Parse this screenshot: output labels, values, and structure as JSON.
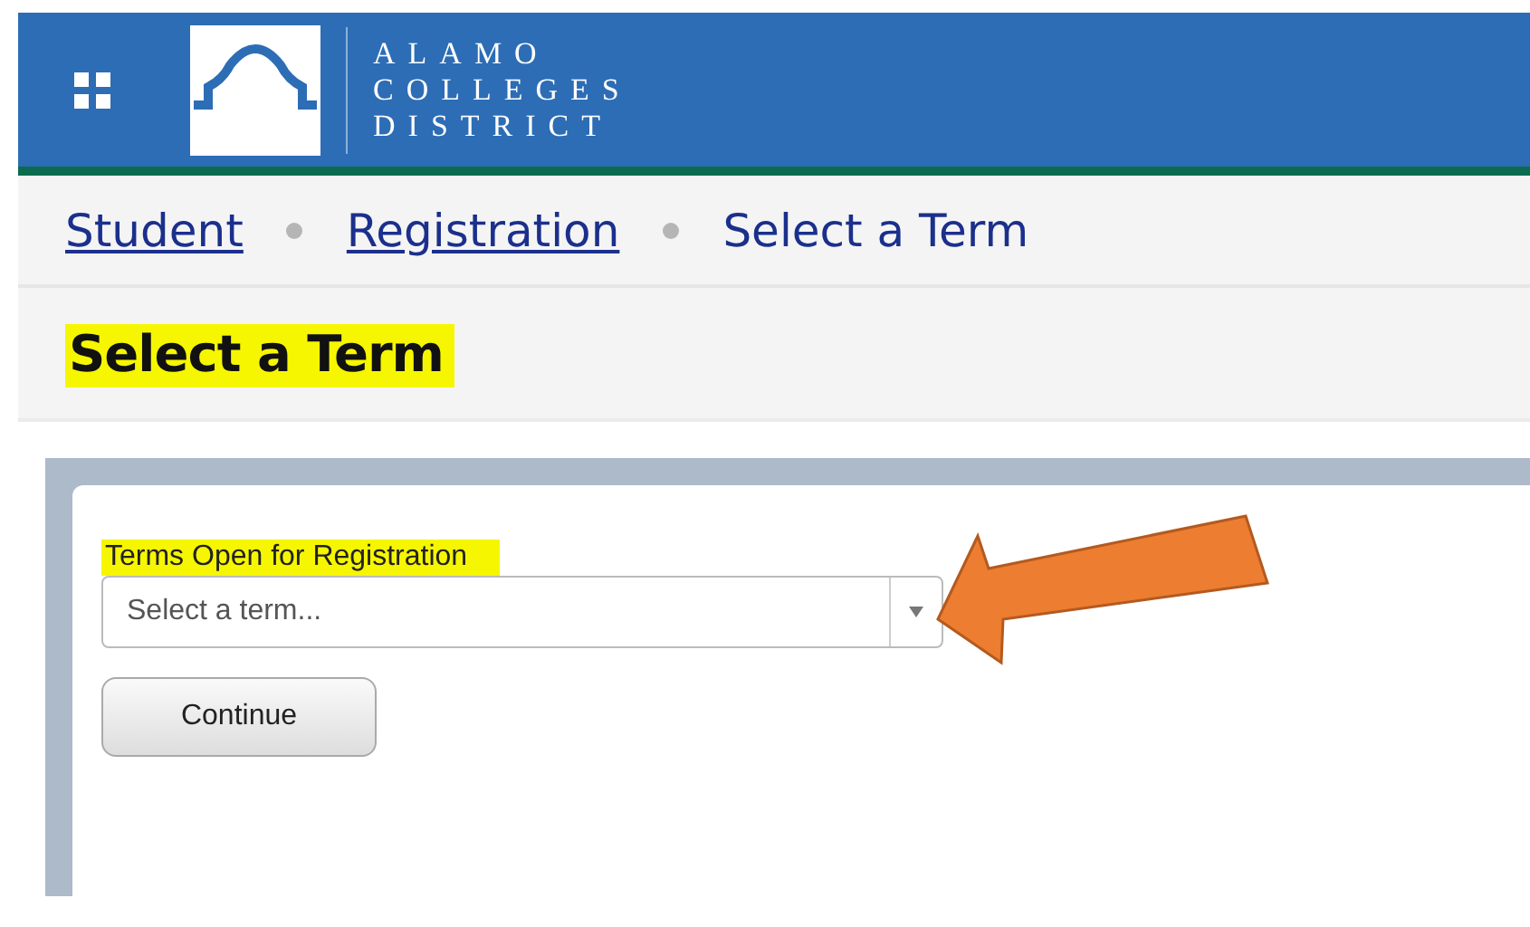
{
  "header": {
    "logo_lines": [
      "ALAMO",
      "COLLEGES",
      "DISTRICT"
    ]
  },
  "breadcrumb": [
    {
      "label": "Student",
      "kind": "link"
    },
    {
      "label": "Registration",
      "kind": "link"
    },
    {
      "label": "Select a Term",
      "kind": "current"
    }
  ],
  "heading": {
    "text": "Select a Term",
    "highlighted": true
  },
  "form": {
    "label": {
      "text": "Terms Open for Registration",
      "highlighted": true
    },
    "term_select": {
      "placeholder": "Select a term..."
    },
    "button": "Continue"
  },
  "annotations": [
    {
      "kind": "arrow",
      "color": "#ed7d31"
    }
  ]
}
